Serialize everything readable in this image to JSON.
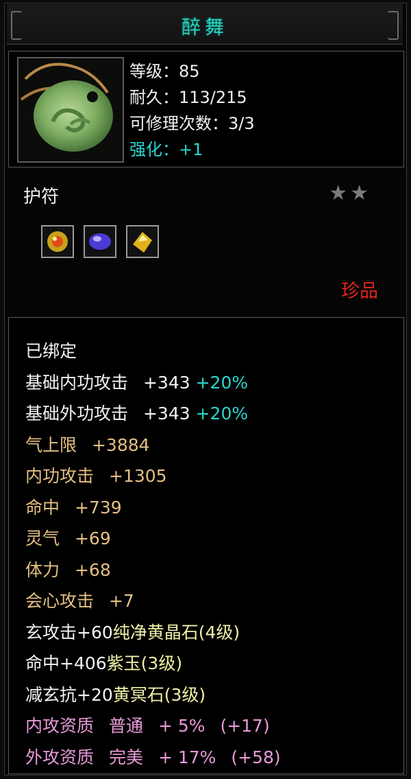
{
  "item": {
    "title": "醉舞",
    "stats": {
      "level": "等级：85",
      "durability": "耐久：113/215",
      "repairs": "可修理次数：3/3",
      "enhance": "强化：+1"
    },
    "type": "护符",
    "stars": "★★",
    "rarity": "珍品",
    "bound": "已绑定",
    "attributes": [
      {
        "name": "基础内功攻击",
        "value": "+343",
        "bonus": "+20%"
      },
      {
        "name": "基础外功攻击",
        "value": "+343",
        "bonus": "+20%"
      },
      {
        "name": "气上限",
        "value": "+3884"
      },
      {
        "name": "内功攻击",
        "value": "+1305"
      },
      {
        "name": "命中",
        "value": "+739"
      },
      {
        "name": "灵气",
        "value": "+69"
      },
      {
        "name": "体力",
        "value": "+68"
      },
      {
        "name": "会心攻击",
        "value": "+7"
      }
    ],
    "gem_lines": [
      {
        "effect": "玄攻击+60",
        "gem": "纯净黄晶石(4级)"
      },
      {
        "effect": "命中+406",
        "gem": "紫玉(3级)"
      },
      {
        "effect": "减玄抗+20",
        "gem": "黄冥石(3级)"
      }
    ],
    "aptitudes": [
      {
        "name": "内攻资质",
        "grade": "普通",
        "pct": "+ 5%",
        "extra": "(+17)"
      },
      {
        "name": "外攻资质",
        "grade": "完美",
        "pct": "+ 17%",
        "extra": "(+58)"
      }
    ]
  }
}
